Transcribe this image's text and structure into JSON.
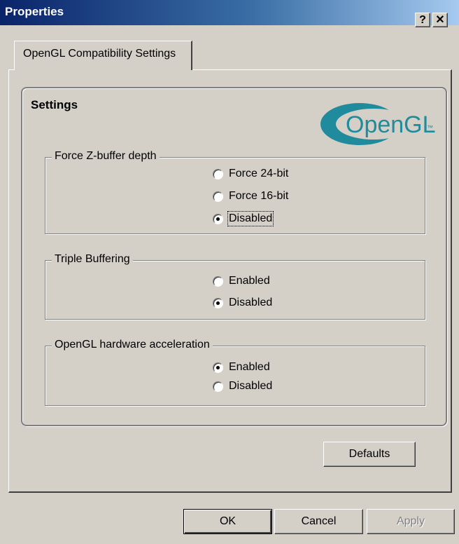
{
  "window": {
    "title": "Properties",
    "help_glyph": "?",
    "close_glyph": "✕"
  },
  "tabs": [
    {
      "label": "OpenGL Compatibility Settings",
      "selected": true
    }
  ],
  "settings": {
    "title": "Settings",
    "logo_text": "OpenGL",
    "logo_tm": "™"
  },
  "groups": {
    "zbuffer": {
      "legend": "Force Z-buffer depth",
      "options": [
        {
          "label": "Force 24-bit",
          "checked": false
        },
        {
          "label": "Force 16-bit",
          "checked": false
        },
        {
          "label": "Disabled",
          "checked": true
        }
      ]
    },
    "triple": {
      "legend": "Triple Buffering",
      "options": [
        {
          "label": "Enabled",
          "checked": false
        },
        {
          "label": "Disabled",
          "checked": true
        }
      ]
    },
    "hwaccel": {
      "legend": "OpenGL hardware acceleration",
      "options": [
        {
          "label": "Enabled",
          "checked": true
        },
        {
          "label": "Disabled",
          "checked": false
        }
      ]
    }
  },
  "buttons": {
    "defaults": "Defaults",
    "ok": "OK",
    "cancel": "Cancel",
    "apply": "Apply"
  },
  "colors": {
    "titlebar_start": "#0a246a",
    "titlebar_end": "#a6caf0",
    "face": "#d4d0c8",
    "logo_teal": "#1f8b9c"
  }
}
